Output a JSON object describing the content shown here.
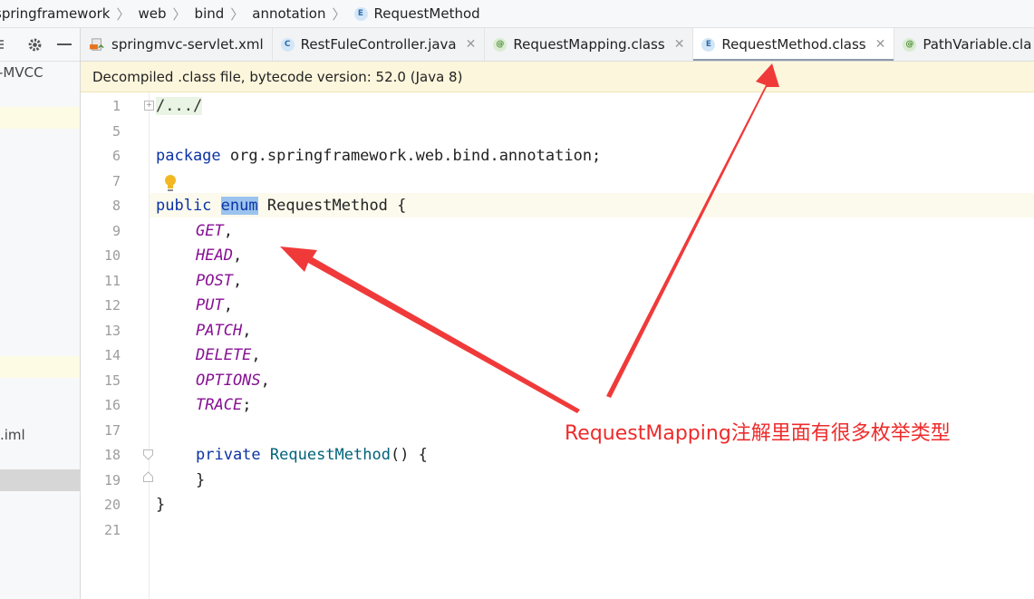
{
  "breadcrumb": {
    "items": [
      "springframework",
      "web",
      "bind",
      "annotation",
      "RequestMethod"
    ]
  },
  "left_panel": {
    "items": [
      "-MVCC",
      ".iml"
    ]
  },
  "tabs": [
    {
      "label": "springmvc-servlet.xml",
      "icon": "xml-file-icon"
    },
    {
      "label": "RestFuleController.java",
      "icon": "class-icon",
      "icon_letter": "C"
    },
    {
      "label": "RequestMapping.class",
      "icon": "annotation-icon",
      "icon_letter": "@"
    },
    {
      "label": "RequestMethod.class",
      "icon": "enum-icon",
      "icon_letter": "E",
      "active": true
    },
    {
      "label": "PathVariable.cla",
      "icon": "annotation-icon",
      "icon_letter": "@"
    }
  ],
  "banner": {
    "text": "Decompiled .class file, bytecode version: 52.0 (Java 8)"
  },
  "code": {
    "line_numbers": [
      "1",
      "5",
      "6",
      "7",
      "8",
      "9",
      "10",
      "11",
      "12",
      "13",
      "14",
      "15",
      "16",
      "17",
      "18",
      "19",
      "20",
      "21"
    ],
    "folded": "/.../",
    "package_kw": "package",
    "package_name": " org.springframework.web.bind.annotation;",
    "public_kw": "public",
    "enum_kw": "enum",
    "class_decl": " RequestMethod {",
    "constants": [
      "GET",
      "HEAD",
      "POST",
      "PUT",
      "PATCH",
      "DELETE",
      "OPTIONS",
      "TRACE"
    ],
    "separators": [
      ",",
      ",",
      ",",
      ",",
      ",",
      ",",
      ",",
      ";"
    ],
    "private_kw": "private",
    "ctor": "RequestMethod",
    "ctor_rest": "() {",
    "close_inner": "}",
    "close_outer": "}"
  },
  "annotation": {
    "text": "RequestMapping注解里面有很多枚举类型",
    "color": "#ee2b2b"
  },
  "colors": {
    "keyword": "#0b33a5",
    "constant": "#871094",
    "banner": "#fcf6dc"
  }
}
